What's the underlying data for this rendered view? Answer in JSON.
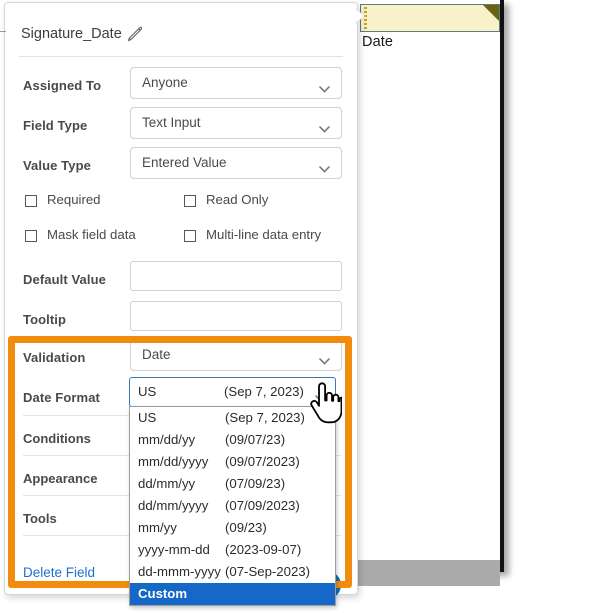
{
  "document": {
    "field_label": "Date",
    "form_field": {
      "name": "signature-date-field",
      "fill_color": "#f7f2c9",
      "corner_color": "#6b6113",
      "border_color": "#5a7a86"
    }
  },
  "panel": {
    "title": "Signature_Date",
    "edit_icon": "pencil-icon",
    "rows": [
      {
        "label": "Assigned To",
        "value": "Anyone",
        "control": "select"
      },
      {
        "label": "Field Type",
        "value": "Text Input",
        "control": "select"
      },
      {
        "label": "Value Type",
        "value": "Entered Value",
        "control": "select"
      }
    ],
    "checkboxes": [
      {
        "label": "Required",
        "checked": false
      },
      {
        "label": "Read Only",
        "checked": false
      },
      {
        "label": "Mask field data",
        "checked": false
      },
      {
        "label": "Multi-line data entry",
        "checked": false
      }
    ],
    "text_rows": [
      {
        "label": "Default Value",
        "value": "",
        "placeholder": ""
      },
      {
        "label": "Tooltip",
        "value": "",
        "placeholder": ""
      }
    ],
    "validation": {
      "label": "Validation",
      "value": "Date"
    },
    "date_format": {
      "label": "Date Format",
      "value": "US",
      "sample": "(Sep 7, 2023)"
    },
    "sections": [
      {
        "label": "Conditions"
      },
      {
        "label": "Appearance"
      },
      {
        "label": "Tools"
      }
    ],
    "delete_link": "Delete Field",
    "footer_buttons": [
      {
        "label": "",
        "style": "secondary"
      },
      {
        "label": "",
        "style": "primary"
      }
    ]
  },
  "dropdown": {
    "open": true,
    "selected": "Custom",
    "items": [
      {
        "format": "US",
        "sample": "(Sep 7, 2023)",
        "selected": false
      },
      {
        "format": "mm/dd/yy",
        "sample": "(09/07/23)",
        "selected": false
      },
      {
        "format": "mm/dd/yyyy",
        "sample": "(09/07/2023)",
        "selected": false
      },
      {
        "format": "dd/mm/yy",
        "sample": "(07/09/23)",
        "selected": false
      },
      {
        "format": "dd/mm/yyyy",
        "sample": "(07/09/2023)",
        "selected": false
      },
      {
        "format": "mm/yy",
        "sample": "(09/23)",
        "selected": false
      },
      {
        "format": "yyyy-mm-dd",
        "sample": "(2023-09-07)",
        "selected": false
      },
      {
        "format": "dd-mmm-yyyy",
        "sample": "(07-Sep-2023)",
        "selected": false
      },
      {
        "format": "Custom",
        "sample": "",
        "selected": true
      }
    ]
  },
  "annotation": {
    "highlight_color": "#f28c0f",
    "cursor": "pointing-hand-cursor"
  },
  "colors": {
    "accent_blue": "#1567c8",
    "link_blue": "#1f6fd0",
    "label_gray": "#4a4a4a",
    "highlight_orange": "#f28c0f",
    "primary_button": "#1473b5"
  }
}
